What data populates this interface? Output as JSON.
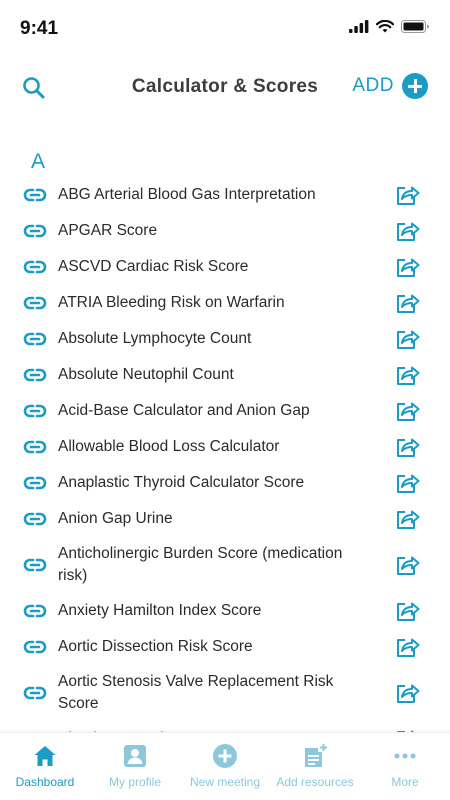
{
  "status_bar": {
    "time": "9:41"
  },
  "header": {
    "title": "Calculator & Scores",
    "add_label": "ADD"
  },
  "section": {
    "letter": "A"
  },
  "items": [
    {
      "label": "ABG Arterial Blood Gas Interpretation"
    },
    {
      "label": "APGAR Score"
    },
    {
      "label": "ASCVD Cardiac Risk Score"
    },
    {
      "label": "ATRIA Bleeding Risk on Warfarin"
    },
    {
      "label": "Absolute Lymphocyte Count"
    },
    {
      "label": "Absolute Neutophil Count"
    },
    {
      "label": "Acid-Base Calculator and Anion Gap"
    },
    {
      "label": "Allowable Blood Loss Calculator"
    },
    {
      "label": "Anaplastic Thyroid Calculator Score"
    },
    {
      "label": "Anion Gap Urine"
    },
    {
      "label": "Anticholinergic Burden Score (medication risk)"
    },
    {
      "label": "Anxiety Hamilton Index Score"
    },
    {
      "label": "Aortic Dissection Risk Score"
    },
    {
      "label": "Aortic Stenosis Valve Replacement Risk Score"
    },
    {
      "label": "Absolute Lymphocyte Count"
    }
  ],
  "tabbar": {
    "tabs": [
      {
        "label": "Dashboard",
        "icon": "home-icon",
        "active": true
      },
      {
        "label": "My profile",
        "icon": "profile-icon",
        "active": false
      },
      {
        "label": "New meeting",
        "icon": "plus-circle-icon",
        "active": false
      },
      {
        "label": "Add resources",
        "icon": "document-add-icon",
        "active": false
      },
      {
        "label": "More",
        "icon": "more-dots-icon",
        "active": false
      }
    ]
  },
  "colors": {
    "accent": "#1a9cc4",
    "accent_light": "#8dc7dc",
    "text": "#2b2b2b"
  }
}
